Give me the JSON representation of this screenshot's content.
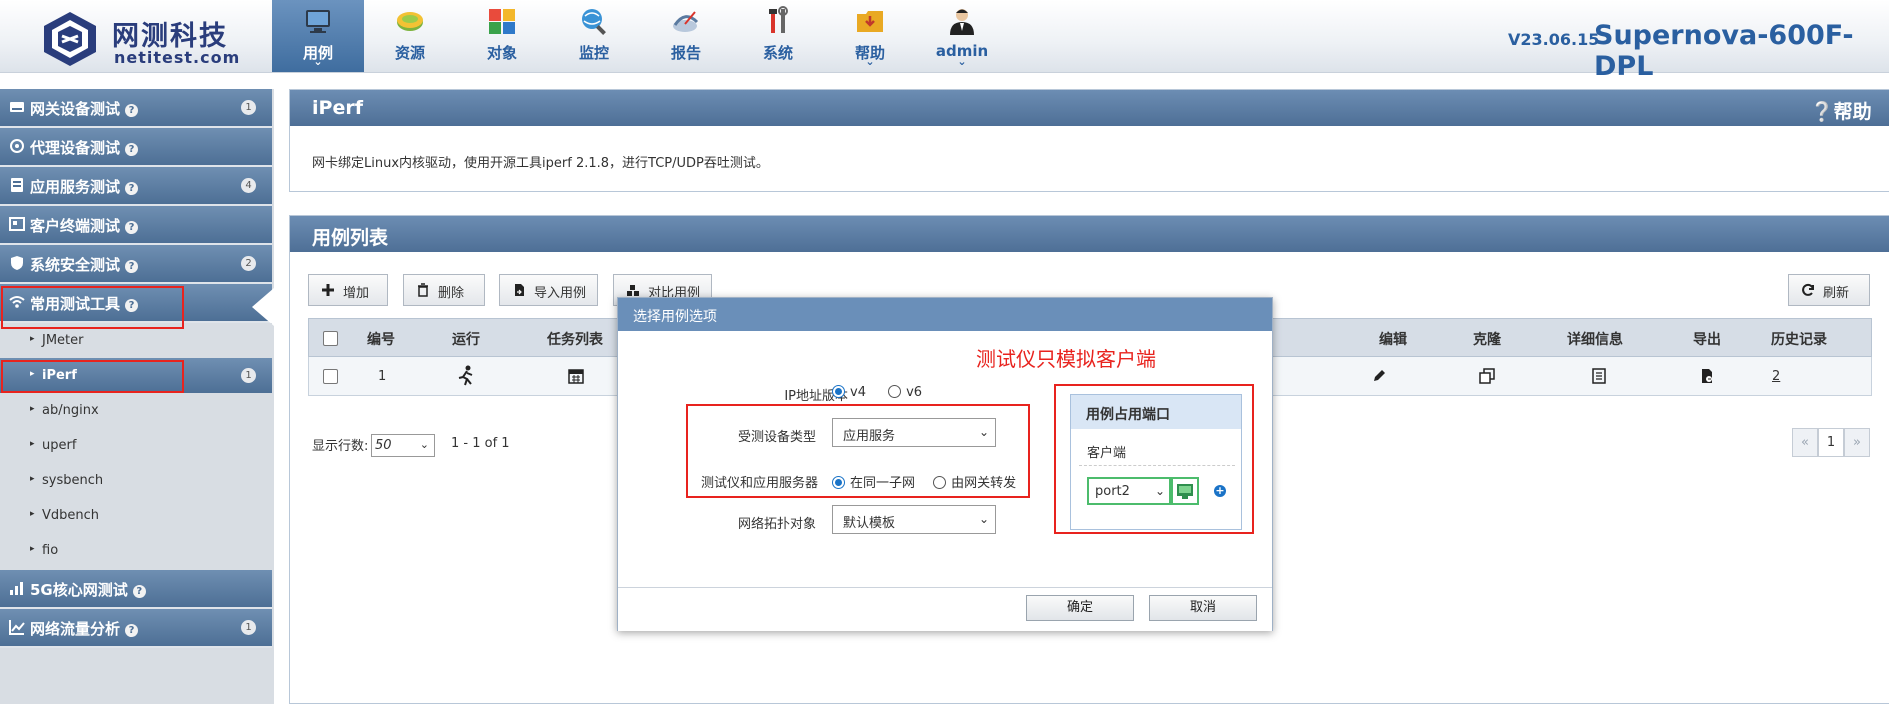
{
  "brand": {
    "name_cn": "网测科技",
    "name_en": "netitest.com",
    "version": "V23.06.15",
    "product": "Supernova-600F-DPL"
  },
  "nav": [
    {
      "label": "用例",
      "icon": "monitor-icon",
      "active": true,
      "caret": true
    },
    {
      "label": "资源",
      "icon": "resource-disc-icon",
      "active": false,
      "caret": false
    },
    {
      "label": "对象",
      "icon": "object-blocks-icon",
      "active": false,
      "caret": false
    },
    {
      "label": "监控",
      "icon": "monitor-globe-icon",
      "active": false,
      "caret": false
    },
    {
      "label": "报告",
      "icon": "report-satellite-icon",
      "active": false,
      "caret": false
    },
    {
      "label": "系统",
      "icon": "tools-icon",
      "active": false,
      "caret": false
    },
    {
      "label": "帮助",
      "icon": "help-folder-icon",
      "active": false,
      "caret": true
    },
    {
      "label": "admin",
      "icon": "user-avatar-icon",
      "active": false,
      "caret": true
    }
  ],
  "sidebar": {
    "categories": [
      {
        "label": "网关设备测试",
        "icon": "gateway-icon",
        "badge": "1"
      },
      {
        "label": "代理设备测试",
        "icon": "proxy-icon",
        "badge": ""
      },
      {
        "label": "应用服务测试",
        "icon": "server-icon",
        "badge": "4"
      },
      {
        "label": "客户终端测试",
        "icon": "terminal-icon",
        "badge": ""
      },
      {
        "label": "系统安全测试",
        "icon": "shield-icon",
        "badge": "2"
      },
      {
        "label": "常用测试工具",
        "icon": "wifi-icon",
        "badge": ""
      }
    ],
    "tools": [
      {
        "label": "JMeter",
        "badge": ""
      },
      {
        "label": "iPerf",
        "badge": "1",
        "active": true
      },
      {
        "label": "ab/nginx",
        "badge": ""
      },
      {
        "label": "uperf",
        "badge": ""
      },
      {
        "label": "sysbench",
        "badge": ""
      },
      {
        "label": "Vdbench",
        "badge": ""
      },
      {
        "label": "fio",
        "badge": ""
      }
    ],
    "bottom": [
      {
        "label": "5G核心网测试",
        "icon": "signal-bars-icon",
        "badge": ""
      },
      {
        "label": "网络流量分析",
        "icon": "line-chart-icon",
        "badge": "1"
      }
    ]
  },
  "info_panel": {
    "title": "iPerf",
    "help": "帮助",
    "description": "网卡绑定Linux内核驱动，使用开源工具iperf 2.1.8，进行TCP/UDP吞吐测试。"
  },
  "list_panel": {
    "title": "用例列表",
    "buttons": {
      "add": "增加",
      "delete": "删除",
      "import": "导入用例",
      "compare": "对比用例",
      "refresh": "刷新"
    },
    "columns": [
      "编号",
      "运行",
      "任务列表",
      "编辑",
      "克隆",
      "详细信息",
      "导出",
      "历史记录"
    ],
    "row": {
      "id": "1",
      "history": "2"
    },
    "pager": {
      "rows_label": "显示行数:",
      "rows_value": "50",
      "range": "1 - 1 of 1",
      "page": "1",
      "prev": "«",
      "next": "»"
    }
  },
  "modal": {
    "title": "选择用例选项",
    "annotation": "测试仪只模拟客户端",
    "ip_version": {
      "label": "IP地址版本",
      "options": [
        "v4",
        "v6"
      ],
      "selected": "v4"
    },
    "device_type": {
      "label": "受测设备类型",
      "value": "应用服务"
    },
    "network": {
      "label": "测试仪和应用服务器",
      "options": [
        "在同一子网",
        "由网关转发"
      ],
      "selected": "在同一子网"
    },
    "topology": {
      "label": "网络拓扑对象",
      "value": "默认模板"
    },
    "port_card": {
      "title": "用例占用端口",
      "client": "客户端",
      "port": "port2"
    },
    "ok": "确定",
    "cancel": "取消"
  }
}
